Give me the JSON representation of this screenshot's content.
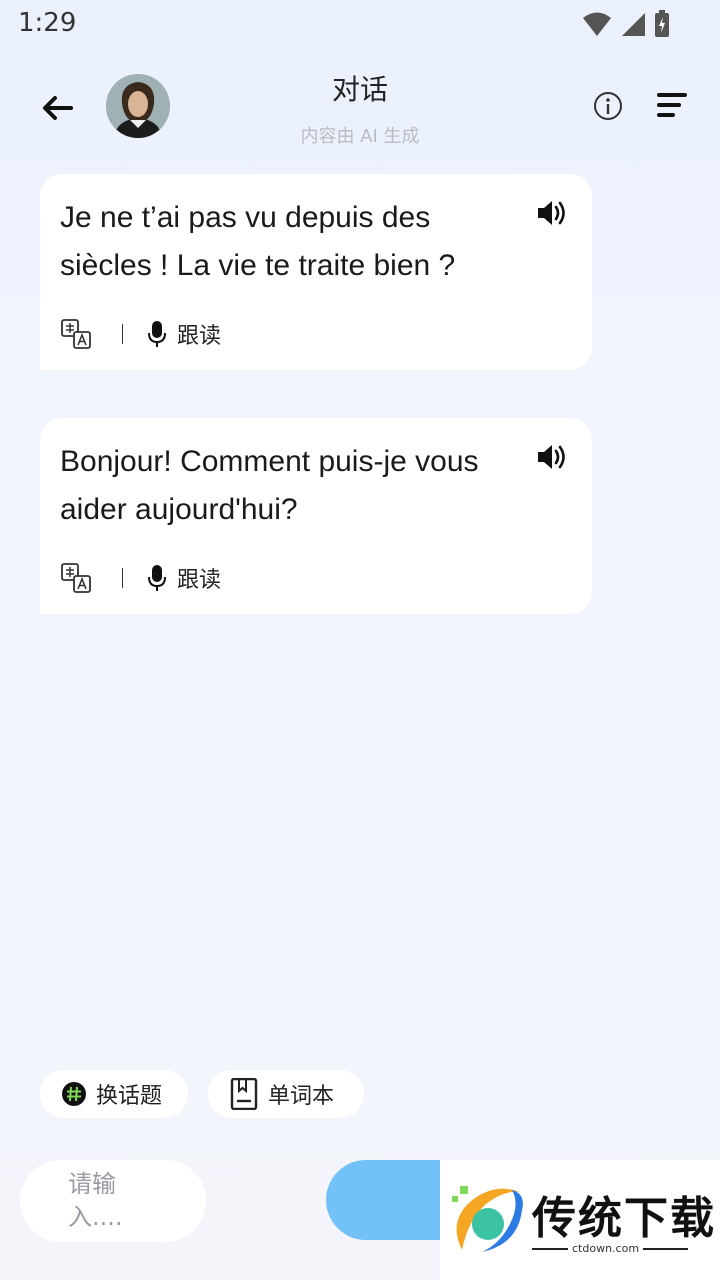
{
  "status": {
    "time": "1:29"
  },
  "header": {
    "title": "对话",
    "subtitle": "内容由 AI 生成"
  },
  "messages": [
    {
      "text": "Je ne t’ai pas vu depuis des siècles ! La vie te traite bien ?",
      "follow_label": "跟读"
    },
    {
      "text": "Bonjour! Comment puis-je vous aider aujourd'hui?",
      "follow_label": "跟读"
    }
  ],
  "chips": {
    "change_topic": "换话题",
    "wordbook": "单词本"
  },
  "input": {
    "placeholder": "请输入...."
  },
  "watermark": {
    "brand": "传统下载",
    "url": "ctdown.com"
  },
  "colors": {
    "send_button": "#72c1f8",
    "accent_green": "#7ed957"
  }
}
